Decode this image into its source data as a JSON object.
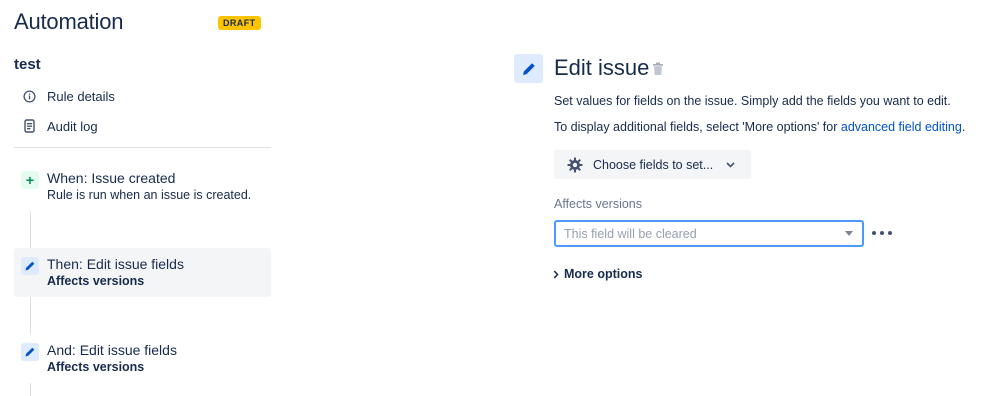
{
  "header": {
    "title": "Automation",
    "status_badge": "DRAFT"
  },
  "rule": {
    "name": "test"
  },
  "nav": {
    "items": [
      {
        "label": "Rule details",
        "icon": "info-icon"
      },
      {
        "label": "Audit log",
        "icon": "document-icon"
      }
    ]
  },
  "steps": [
    {
      "title": "When: Issue created",
      "subtitle": "Rule is run when an issue is created.",
      "icon": "plus-icon",
      "selected": false
    },
    {
      "title": "Then: Edit issue fields",
      "subtitle": "Affects versions",
      "icon": "pencil-icon",
      "selected": true
    },
    {
      "title": "And: Edit issue fields",
      "subtitle": "Affects versions",
      "icon": "pencil-icon",
      "selected": false
    }
  ],
  "panel": {
    "title": "Edit issue",
    "description": "Set values for fields on the issue. Simply add the fields you want to edit.",
    "help_prefix": "To display additional fields, select 'More options' for ",
    "help_link": "advanced field editing",
    "help_suffix": ".",
    "choose_fields_label": "Choose fields to set...",
    "field": {
      "label": "Affects versions",
      "placeholder": "This field will be cleared"
    },
    "more_options_label": "More options"
  },
  "colors": {
    "text": "#172b4d",
    "link": "#0052cc",
    "badge": "#ffc400",
    "focus_border": "#4c9aff",
    "trigger_icon_bg": "#e3fcef",
    "action_icon_bg": "#deebff"
  }
}
